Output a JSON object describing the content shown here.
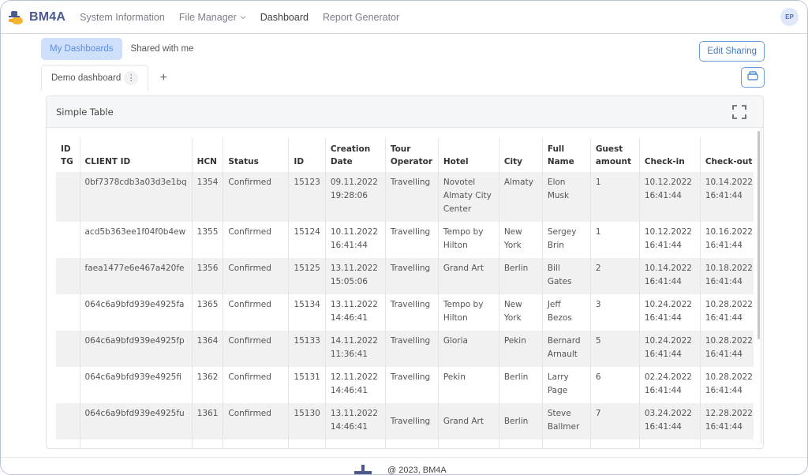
{
  "app": {
    "brand": "BM4A",
    "avatar_initials": "EP"
  },
  "nav": {
    "items": [
      {
        "label": "System Information",
        "active": false,
        "dropdown": false
      },
      {
        "label": "File Manager",
        "active": false,
        "dropdown": true
      },
      {
        "label": "Dashboard",
        "active": true,
        "dropdown": false
      },
      {
        "label": "Report Generator",
        "active": false,
        "dropdown": false
      }
    ],
    "dropdown_caret": "⌵"
  },
  "subtabs": [
    {
      "label": "My Dashboards",
      "active": true
    },
    {
      "label": "Shared with me",
      "active": false
    }
  ],
  "toolbar": {
    "edit_sharing_label": "Edit Sharing",
    "print_icon": "print-icon"
  },
  "dashboard_tabs": {
    "tabs": [
      {
        "label": "Demo dashboard",
        "menu_glyph": "⋮"
      }
    ],
    "add_glyph": "+"
  },
  "widget": {
    "title": "Simple Table",
    "fullscreen_icon": "fullscreen-icon",
    "table": {
      "columns": [
        [
          "ID",
          "TG"
        ],
        [
          "CLIENT ID"
        ],
        [
          "HCN"
        ],
        [
          "Status"
        ],
        [
          "ID"
        ],
        [
          "Creation",
          "Date"
        ],
        [
          "Tour",
          "Operator"
        ],
        [
          "Hotel"
        ],
        [
          "City"
        ],
        [
          "Full",
          "Name"
        ],
        [
          "Guest",
          "amount"
        ],
        [
          "Check-in"
        ],
        [
          "Check-out"
        ]
      ],
      "rows": [
        [
          [
            ""
          ],
          [
            "0bf7378cdb3a03d3e1bq"
          ],
          [
            "1354"
          ],
          [
            "Confirmed"
          ],
          [
            "15123"
          ],
          [
            "09.11.2022",
            "19:28:06"
          ],
          [
            "Travelling"
          ],
          [
            "Novotel",
            "Almaty City",
            "Center"
          ],
          [
            "Almaty"
          ],
          [
            "Elon",
            "Musk"
          ],
          [
            "1"
          ],
          [
            "10.12.2022",
            "16:41:44"
          ],
          [
            "10.14.2022",
            "16:41:44"
          ]
        ],
        [
          [
            ""
          ],
          [
            "acd5b363ee1f04f0b4ew"
          ],
          [
            "1355"
          ],
          [
            "Confirmed"
          ],
          [
            "15124"
          ],
          [
            "10.11.2022",
            "16:41:44"
          ],
          [
            "Travelling"
          ],
          [
            "Tempo by",
            "Hilton"
          ],
          [
            "New",
            "York"
          ],
          [
            "Sergey",
            "Brin"
          ],
          [
            "1"
          ],
          [
            "10.12.2022",
            "16:41:44"
          ],
          [
            "10.16.2022",
            "16:41:44"
          ]
        ],
        [
          [
            ""
          ],
          [
            "faea1477e6e467a420fe"
          ],
          [
            "1356"
          ],
          [
            "Confirmed"
          ],
          [
            "15125"
          ],
          [
            "13.11.2022",
            "15:05:06"
          ],
          [
            "Travelling"
          ],
          [
            "Grand Art"
          ],
          [
            "Berlin"
          ],
          [
            "Bill Gates"
          ],
          [
            "2"
          ],
          [
            "10.14.2022",
            "16:41:44"
          ],
          [
            "10.18.2022",
            "16:41:44"
          ]
        ],
        [
          [
            ""
          ],
          [
            "064c6a9bfd939e4925fa"
          ],
          [
            "1365"
          ],
          [
            "Confirmed"
          ],
          [
            "15134"
          ],
          [
            "13.11.2022",
            "14:46:41"
          ],
          [
            "Travelling"
          ],
          [
            "Tempo by",
            "Hilton"
          ],
          [
            "New",
            "York"
          ],
          [
            "Jeff",
            "Bezos"
          ],
          [
            "3"
          ],
          [
            "10.24.2022",
            "16:41:44"
          ],
          [
            "10.28.2022",
            "16:41:44"
          ]
        ],
        [
          [
            ""
          ],
          [
            "064c6a9bfd939e4925fp"
          ],
          [
            "1364"
          ],
          [
            "Confirmed"
          ],
          [
            "15133"
          ],
          [
            "14.11.2022",
            "11:36:41"
          ],
          [
            "Travelling"
          ],
          [
            "Gloria"
          ],
          [
            "Pekin"
          ],
          [
            "Bernard",
            "Arnault"
          ],
          [
            "5"
          ],
          [
            "10.24.2022",
            "16:41:44"
          ],
          [
            "10.28.2022",
            "16:41:44"
          ]
        ],
        [
          [
            ""
          ],
          [
            "064c6a9bfd939e4925fi"
          ],
          [
            "1362"
          ],
          [
            "Confirmed"
          ],
          [
            "15131"
          ],
          [
            "12.11.2022",
            "14:46:41"
          ],
          [
            "Travelling"
          ],
          [
            "Pekin"
          ],
          [
            "Berlin"
          ],
          [
            "Larry",
            "Page"
          ],
          [
            "6"
          ],
          [
            "02.24.2022",
            "16:41:44"
          ],
          [
            "10.28.2022",
            "16:41:44"
          ]
        ],
        [
          [
            ""
          ],
          [
            "064c6a9bfd939e4925fu"
          ],
          [
            "1361"
          ],
          [
            "Confirmed"
          ],
          [
            "15130"
          ],
          [
            "13.11.2022",
            "14:46:41"
          ],
          [
            "Travelling"
          ],
          [
            "Grand Art"
          ],
          [
            "Berlin"
          ],
          [
            "Steve",
            "Ballmer"
          ],
          [
            "7"
          ],
          [
            "03.24.2022",
            "16:41:44"
          ],
          [
            "12.28.2022",
            "16:41:44"
          ]
        ]
      ]
    }
  },
  "footer": {
    "text": "@ 2023, BM4A"
  },
  "colors": {
    "brand": "#4b5a8f",
    "accent": "#3f78c9",
    "active_subtab_bg": "#cfe0fb"
  }
}
